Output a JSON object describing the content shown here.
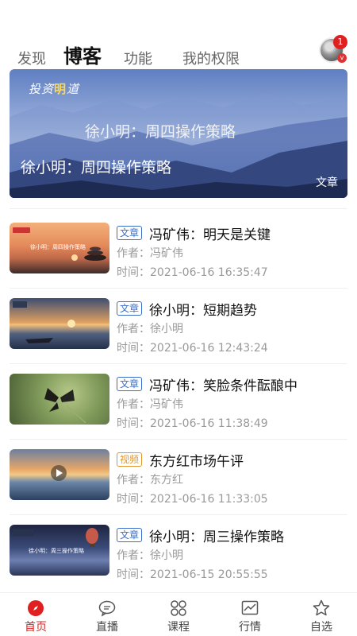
{
  "top_tabs": [
    "发现",
    "博客",
    "功能",
    "我的权限"
  ],
  "active_tab": "博客",
  "avatar_badge": "1",
  "avatar_mark": "v",
  "banner": {
    "logo_text_a": "投资",
    "logo_text_b": "明",
    "logo_text_c": "道",
    "title_faded": "徐小明：周四操作策略",
    "title": "徐小明：周四操作策略",
    "tag": "文章"
  },
  "items": [
    {
      "tag": "文章",
      "title": "冯矿伟：明天是关键",
      "author": "作者：冯矿伟",
      "time": "时间：2021-06-16 16:35:47",
      "thumb_caption": "徐小明：周四操作策略"
    },
    {
      "tag": "文章",
      "title": "徐小明：短期趋势",
      "author": "作者：徐小明",
      "time": "时间：2021-06-16 12:43:24"
    },
    {
      "tag": "文章",
      "title": "冯矿伟：笑脸条件酝酿中",
      "author": "作者：冯矿伟",
      "time": "时间：2021-06-16 11:38:49"
    },
    {
      "tag": "视频",
      "title": "东方红市场午评",
      "author": "作者：东方红",
      "time": "时间：2021-06-16 11:33:05"
    },
    {
      "tag": "文章",
      "title": "徐小明：周三操作策略",
      "author": "作者：徐小明",
      "time": "时间：2021-06-15 20:55:55",
      "thumb_caption": "徐小明：周三操作策略"
    }
  ],
  "bottom_nav": [
    {
      "label": "首页",
      "icon": "compass-icon",
      "active": true
    },
    {
      "label": "直播",
      "icon": "chat-bubble-icon",
      "active": false
    },
    {
      "label": "课程",
      "icon": "grid-icon",
      "active": false
    },
    {
      "label": "行情",
      "icon": "chart-icon",
      "active": false
    },
    {
      "label": "自选",
      "icon": "star-icon",
      "active": false
    }
  ],
  "colors": {
    "accent_red": "#e02020",
    "article_tag": "#3b6ec7",
    "video_tag": "#e0962a",
    "meta_gray": "#999999"
  }
}
